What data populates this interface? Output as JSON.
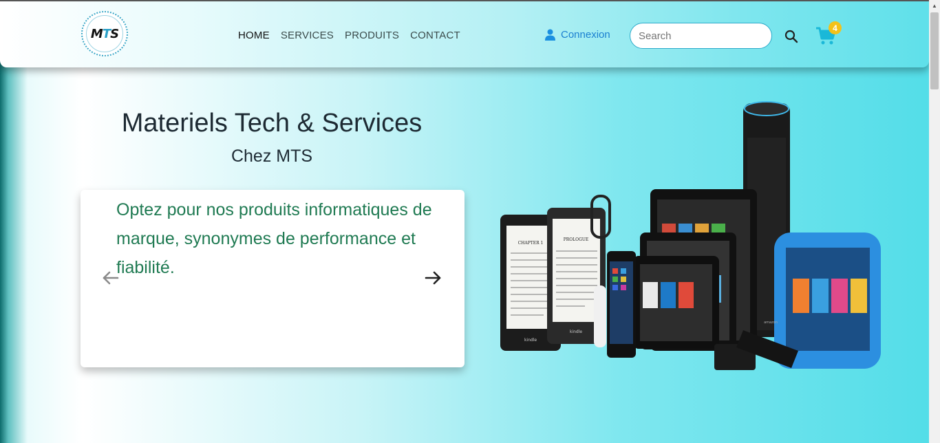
{
  "logo": {
    "text_m": "M",
    "text_t": "T",
    "text_s": "S"
  },
  "nav": {
    "items": [
      {
        "label": "HOME",
        "active": true
      },
      {
        "label": "SERVICES",
        "active": false
      },
      {
        "label": "PRODUITS",
        "active": false
      },
      {
        "label": "CONTACT",
        "active": false
      }
    ],
    "connexion_label": "Connexion",
    "search_placeholder": "Search",
    "cart_count": "4",
    "icons": {
      "user": "user-icon",
      "search": "search-icon",
      "cart": "cart-icon"
    },
    "accent_color": "#1a7fd0",
    "badge_color": "#f3c21a"
  },
  "hero": {
    "title": "Materiels Tech & Services",
    "subtitle": "Chez MTS",
    "card_text": "Optez pour nos produits informatiques de marque, synonymes de performance et fiabilité.",
    "text_color": "#1f7a52",
    "prev_icon": "arrow-left-icon",
    "next_icon": "arrow-right-icon"
  },
  "image": {
    "kindle_label_1": "CHAPTER 1",
    "kindle_label_2": "PROLOGUE",
    "brand_1": "kindle",
    "brand_2": "kindle",
    "brand_3": "amazon"
  }
}
